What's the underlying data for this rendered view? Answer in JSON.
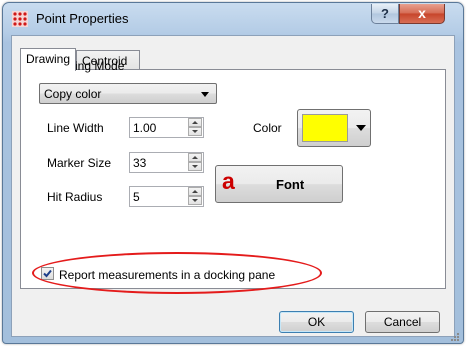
{
  "window": {
    "title": "Point Properties",
    "help_label": "?",
    "close_label": "x",
    "icons": {
      "app": "grid-points-icon"
    }
  },
  "tabs": [
    {
      "label": "Drawing",
      "active": true
    },
    {
      "label": "Centroid",
      "active": false
    }
  ],
  "drawing": {
    "mode_label": "Drawing Mode",
    "mode_value": "Copy color",
    "line_width_label": "Line Width",
    "line_width_value": "1.00",
    "marker_size_label": "Marker Size",
    "marker_size_value": "33",
    "hit_radius_label": "Hit Radius",
    "hit_radius_value": "5",
    "color_label": "Color",
    "color_value": "#ffff00",
    "font_icon_glyph": "a",
    "font_button_label": "Font",
    "report_checkbox_label": "Report measurements in a docking pane",
    "report_checked": true
  },
  "buttons": {
    "ok": "OK",
    "cancel": "Cancel"
  },
  "colors": {
    "highlight": "#e41b1b",
    "font_icon": "#cc0000"
  }
}
